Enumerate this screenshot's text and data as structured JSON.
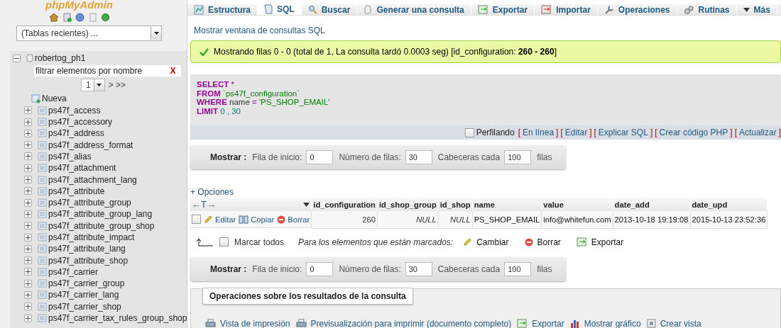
{
  "sidebar": {
    "logo": "phpMyAdmin",
    "recent_select": {
      "value": "(Tablas recientes) ..."
    },
    "tree": {
      "database": "robertog_ph1",
      "expanded": true,
      "filter": {
        "placeholder": "filtrar elementos por nombre",
        "clear": "X"
      },
      "page_select": {
        "value": "1"
      },
      "page_next": "> >>",
      "new_item": "Nueva",
      "tables": [
        {
          "name": "ps47f_access",
          "expanded": false
        },
        {
          "name": "ps47f_accessory",
          "expanded": false
        },
        {
          "name": "ps47f_address",
          "expanded": false
        },
        {
          "name": "ps47f_address_format",
          "expanded": false
        },
        {
          "name": "ps47f_alias",
          "expanded": false
        },
        {
          "name": "ps47f_attachment",
          "expanded": false
        },
        {
          "name": "ps47f_attachment_lang",
          "expanded": false
        },
        {
          "name": "ps47f_attribute",
          "expanded": false
        },
        {
          "name": "ps47f_attribute_group",
          "expanded": false
        },
        {
          "name": "ps47f_attribute_group_lang",
          "expanded": false
        },
        {
          "name": "ps47f_attribute_group_shop",
          "expanded": false
        },
        {
          "name": "ps47f_attribute_impact",
          "expanded": false
        },
        {
          "name": "ps47f_attribute_lang",
          "expanded": false
        },
        {
          "name": "ps47f_attribute_shop",
          "expanded": false
        },
        {
          "name": "ps47f_carrier",
          "expanded": false
        },
        {
          "name": "ps47f_carrier_group",
          "expanded": false
        },
        {
          "name": "ps47f_carrier_lang",
          "expanded": false
        },
        {
          "name": "ps47f_carrier_shop",
          "expanded": false
        },
        {
          "name": "ps47f_carrier_tax_rules_group_shop",
          "expanded": false
        }
      ]
    }
  },
  "tabs": [
    {
      "label": "Estructura",
      "selected": false
    },
    {
      "label": "SQL",
      "selected": true
    },
    {
      "label": "Buscar",
      "selected": false
    },
    {
      "label": "Generar una consulta",
      "selected": false
    },
    {
      "label": "Exportar",
      "selected": false
    },
    {
      "label": "Importar",
      "selected": false
    },
    {
      "label": "Operaciones",
      "selected": false
    },
    {
      "label": "Rutinas",
      "selected": false
    },
    {
      "label": "Más",
      "selected": false
    }
  ],
  "show_query_window": "Mostrar ventana de consultas SQL",
  "message": "Mostrando filas 0 - 0 (total de 1, La consulta tardó 0.0003 seg) [id_configuration: **260 - 260**]",
  "sql": [
    [
      {
        "kind": "keyword",
        "text": "SELECT"
      },
      {
        "kind": "op",
        "text": " *"
      }
    ],
    [
      {
        "kind": "keyword",
        "text": "FROM"
      },
      {
        "kind": "string",
        "text": " `ps47f_configuration`"
      }
    ],
    [
      {
        "kind": "keyword",
        "text": "WHERE"
      },
      {
        "kind": "plain",
        "text": " name "
      },
      {
        "kind": "op",
        "text": "="
      },
      {
        "kind": "string",
        "text": " 'PS_SHOP_EMAIL'"
      }
    ],
    [
      {
        "kind": "keyword",
        "text": "LIMIT"
      },
      {
        "kind": "number",
        "text": " 0 , 30"
      }
    ]
  ],
  "sql_actions": {
    "profiling": {
      "label": "Perfilando",
      "checked": false
    },
    "links": [
      {
        "open": "[",
        "label": "En línea",
        "close": "]"
      },
      {
        "open": "[",
        "label": "Editar",
        "close": "]"
      },
      {
        "open": "[",
        "label": "Explicar SQL",
        "close": "]"
      },
      {
        "open": "[",
        "label": "Crear código PHP",
        "close": "]"
      },
      {
        "open": "[",
        "label": "Actualizar",
        "close": "]"
      }
    ]
  },
  "navigation": [
    {
      "label": "Mostrar :",
      "start_label": "Fila de inicio:",
      "start": "0",
      "rows_label": "Número de filas:",
      "rows": "30",
      "headers_label": "Cabeceras cada",
      "headers": "100",
      "unit": "filas"
    },
    {
      "label": "Mostrar :",
      "start_label": "Fila de inicio:",
      "start": "0",
      "rows_label": "Número de filas:",
      "rows": "30",
      "headers_label": "Cabeceras cada",
      "headers": "100",
      "unit": "filas"
    }
  ],
  "options_link": "+ Opciones",
  "table": {
    "column_toggle": "←T→",
    "columns": [
      "id_configuration",
      "id_shop_group",
      "id_shop",
      "name",
      "value",
      "date_add",
      "date_upd"
    ],
    "rows": [
      {
        "checked": false,
        "actions": [
          "Editar",
          "Copiar",
          "Borrar"
        ],
        "cells": [
          {
            "text": "260",
            "kind": "number"
          },
          {
            "text": "NULL",
            "kind": "null"
          },
          {
            "text": "NULL",
            "kind": "null"
          },
          {
            "text": "PS_SHOP_EMAIL",
            "kind": "text"
          },
          {
            "text": "info@whitefun.com",
            "kind": "text"
          },
          {
            "text": "2013-10-18 19:19:08",
            "kind": "text"
          },
          {
            "text": "2015-10-13 23:52:36",
            "kind": "text"
          }
        ]
      }
    ]
  },
  "bulk": {
    "check_all": {
      "label": "Marcar todos",
      "checked": false
    },
    "hint": "Para los elementos que están marcados:",
    "actions": [
      "Cambiar",
      "Borrar",
      "Exportar"
    ]
  },
  "operations": {
    "title": "Operaciones sobre los resultados de la consulta",
    "links": [
      "Vista de impresión",
      "Previsualización para imprimir (documento completo)",
      "Exportar",
      "Mostrar gráfico",
      "Crear vista"
    ]
  }
}
